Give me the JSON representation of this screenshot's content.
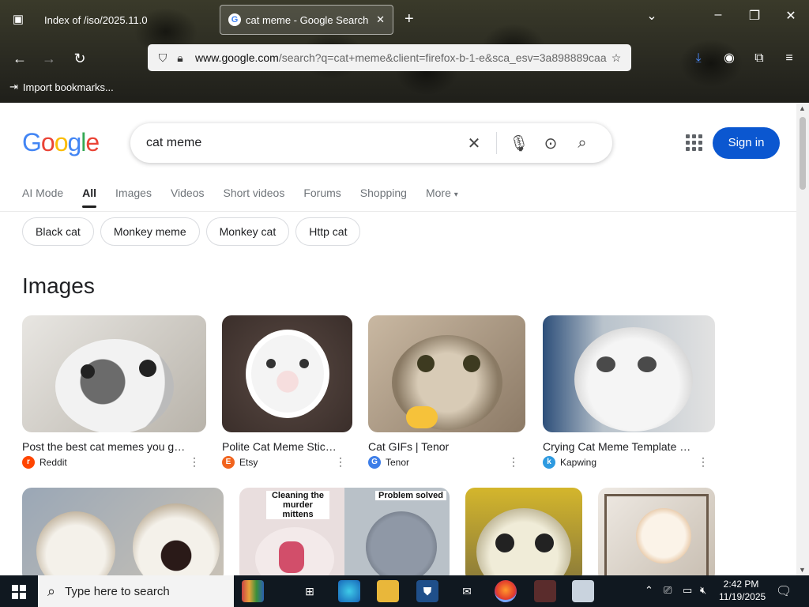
{
  "browser": {
    "tabs": [
      {
        "title": "Index of /iso/2025.11.0",
        "active": false
      },
      {
        "title": "cat meme - Google Search",
        "active": true
      }
    ],
    "url_host": "www.google.com",
    "url_rest": "/search?q=cat+meme&client=firefox-b-1-e&sca_esv=3a898889caa",
    "bookmark_label": "Import bookmarks..."
  },
  "google": {
    "logo_text": "Google",
    "query": "cat meme",
    "signin_label": "Sign in",
    "tabs": [
      "AI Mode",
      "All",
      "Images",
      "Videos",
      "Short videos",
      "Forums",
      "Shopping",
      "More"
    ],
    "active_tab": "All",
    "chips": [
      "Black cat",
      "Monkey meme",
      "Monkey cat",
      "Http cat"
    ],
    "images_heading": "Images",
    "image_results": [
      {
        "caption": "Post the best cat memes you got i...",
        "source": "Reddit",
        "source_color": "#ff4500",
        "source_glyph": "r"
      },
      {
        "caption": "Polite Cat Meme Sticke...",
        "source": "Etsy",
        "source_color": "#f1641e",
        "source_glyph": "E"
      },
      {
        "caption": "Cat GIFs | Tenor",
        "source": "Tenor",
        "source_color": "#3d7ee8",
        "source_glyph": "G"
      },
      {
        "caption": "Crying Cat Meme Template — K...",
        "source": "Kapwing",
        "source_color": "#2e9ae0",
        "source_glyph": "k"
      }
    ],
    "row2_labels": [
      "Cleaning the murder mittens",
      "Problem solved"
    ]
  },
  "taskbar": {
    "search_placeholder": "Type here to search",
    "time": "2:42 PM",
    "date": "11/19/2025"
  }
}
